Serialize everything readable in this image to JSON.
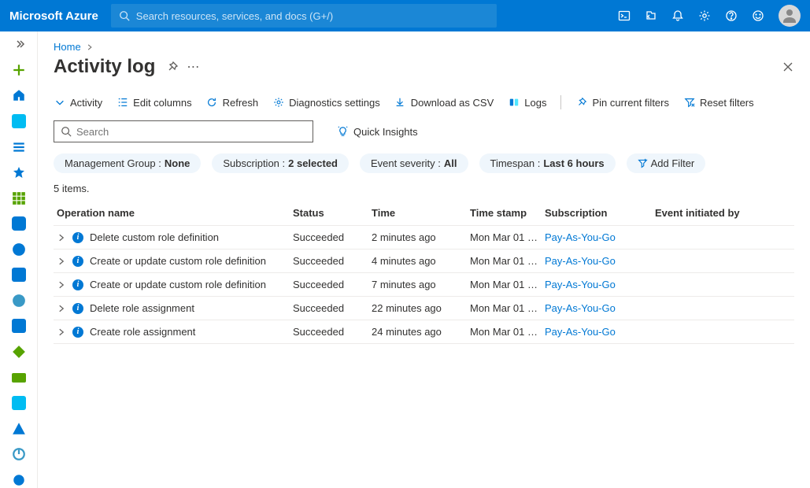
{
  "brand": "Microsoft Azure",
  "global_search_placeholder": "Search resources, services, and docs (G+/)",
  "breadcrumb": {
    "home": "Home"
  },
  "title": "Activity log",
  "toolbar": {
    "activity": "Activity",
    "edit_columns": "Edit columns",
    "refresh": "Refresh",
    "diagnostics": "Diagnostics settings",
    "download_csv": "Download as CSV",
    "logs": "Logs",
    "pin_filters": "Pin current filters",
    "reset_filters": "Reset filters"
  },
  "search_placeholder": "Search",
  "quick_insights": "Quick Insights",
  "filters": {
    "mg_label": "Management Group : ",
    "mg_value": "None",
    "sub_label": "Subscription : ",
    "sub_value": "2 selected",
    "sev_label": "Event severity : ",
    "sev_value": "All",
    "ts_label": "Timespan : ",
    "ts_value": "Last 6 hours",
    "add_filter": "Add Filter"
  },
  "count": "5 items.",
  "columns": {
    "op": "Operation name",
    "status": "Status",
    "time": "Time",
    "ts": "Time stamp",
    "sub": "Subscription",
    "init": "Event initiated by"
  },
  "rows": [
    {
      "op": "Delete custom role definition",
      "status": "Succeeded",
      "time": "2 minutes ago",
      "ts": "Mon Mar 01 …",
      "sub": "Pay-As-You-Go",
      "init": ""
    },
    {
      "op": "Create or update custom role definition",
      "status": "Succeeded",
      "time": "4 minutes ago",
      "ts": "Mon Mar 01 …",
      "sub": "Pay-As-You-Go",
      "init": ""
    },
    {
      "op": "Create or update custom role definition",
      "status": "Succeeded",
      "time": "7 minutes ago",
      "ts": "Mon Mar 01 …",
      "sub": "Pay-As-You-Go",
      "init": ""
    },
    {
      "op": "Delete role assignment",
      "status": "Succeeded",
      "time": "22 minutes ago",
      "ts": "Mon Mar 01 …",
      "sub": "Pay-As-You-Go",
      "init": ""
    },
    {
      "op": "Create role assignment",
      "status": "Succeeded",
      "time": "24 minutes ago",
      "ts": "Mon Mar 01 …",
      "sub": "Pay-As-You-Go",
      "init": ""
    }
  ]
}
